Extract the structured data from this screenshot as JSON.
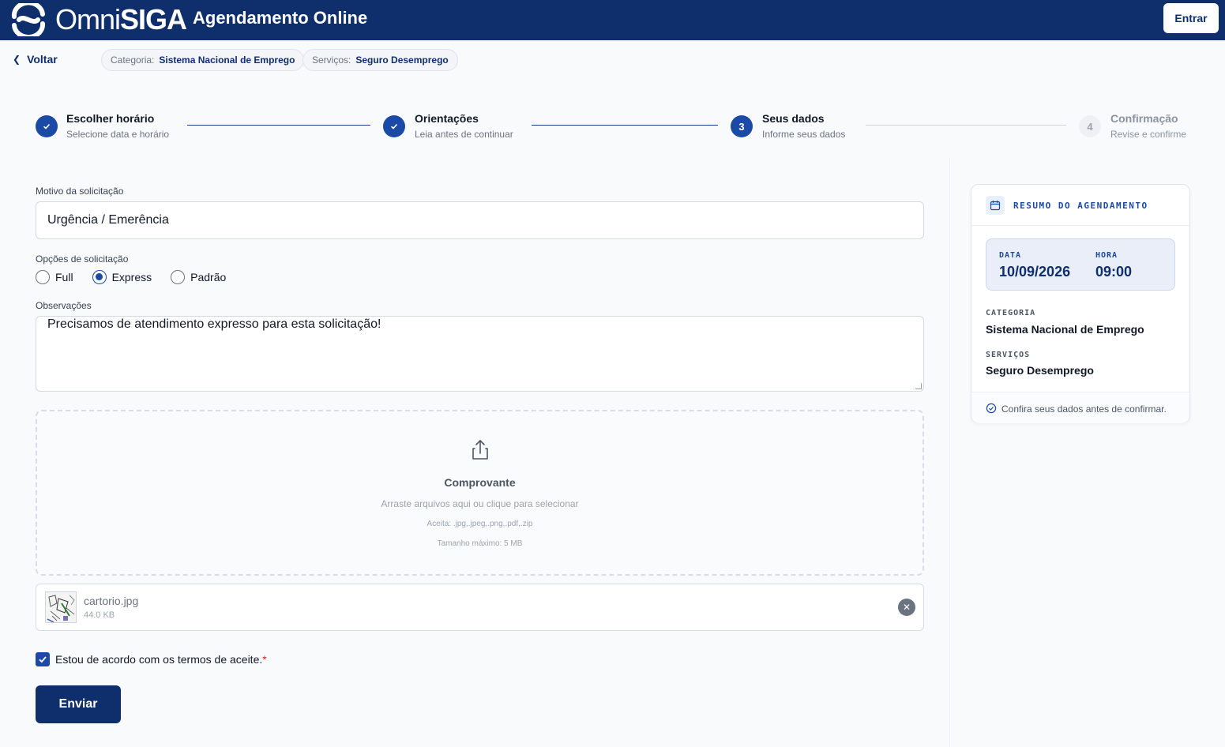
{
  "header": {
    "logo_light": "Omni",
    "logo_bold": "SIGA",
    "title": "Agendamento Online",
    "login_label": "Entrar"
  },
  "breadcrumb": {
    "back_label": "Voltar",
    "category_key": "Categoria:",
    "category_value": "Sistema Nacional de Emprego",
    "service_key": "Serviços:",
    "service_value": "Seguro Desemprego"
  },
  "stepper": {
    "steps": [
      {
        "number": "1",
        "title": "Escolher horário",
        "subtitle": "Selecione data e horário",
        "state": "done"
      },
      {
        "number": "2",
        "title": "Orientações",
        "subtitle": "Leia antes de continuar",
        "state": "done"
      },
      {
        "number": "3",
        "title": "Seus dados",
        "subtitle": "Informe seus dados",
        "state": "current"
      },
      {
        "number": "4",
        "title": "Confirmação",
        "subtitle": "Revise e confirme",
        "state": "pending"
      }
    ]
  },
  "form": {
    "reason_label": "Motivo da solicitação",
    "reason_value": "Urgência / Emerência",
    "options_label": "Opções de solicitação",
    "options": [
      {
        "label": "Full",
        "selected": false
      },
      {
        "label": "Express",
        "selected": true
      },
      {
        "label": "Padrão",
        "selected": false
      }
    ],
    "notes_label": "Observações",
    "notes_value": "Precisamos de atendimento expresso para esta solicitação!",
    "upload": {
      "title": "Comprovante",
      "hint": "Arraste arquivos aqui ou clique para selecionar",
      "accept": "Aceita: .jpg,.jpeg,.png,.pdf,.zip",
      "max_size": "Tamanho máximo: 5 MB"
    },
    "file": {
      "name": "cartorio.jpg",
      "size": "44.0 KB"
    },
    "terms_label": "Estou de acordo com os termos de aceite.",
    "terms_required_mark": "*",
    "terms_checked": true,
    "submit_label": "Enviar"
  },
  "summary": {
    "title": "RESUMO DO AGENDAMENTO",
    "date_label": "DATA",
    "date_value": "10/09/2026",
    "time_label": "HORA",
    "time_value": "09:00",
    "category_label": "CATEGORIA",
    "category_value": "Sistema Nacional de Emprego",
    "services_label": "SERVIÇOS",
    "services_value": "Seguro Desemprego",
    "footer_note": "Confira seus dados antes de confirmar."
  },
  "colors": {
    "brand": "#0e2f6b",
    "accent": "#1a49a6",
    "required": "#dc2626"
  }
}
